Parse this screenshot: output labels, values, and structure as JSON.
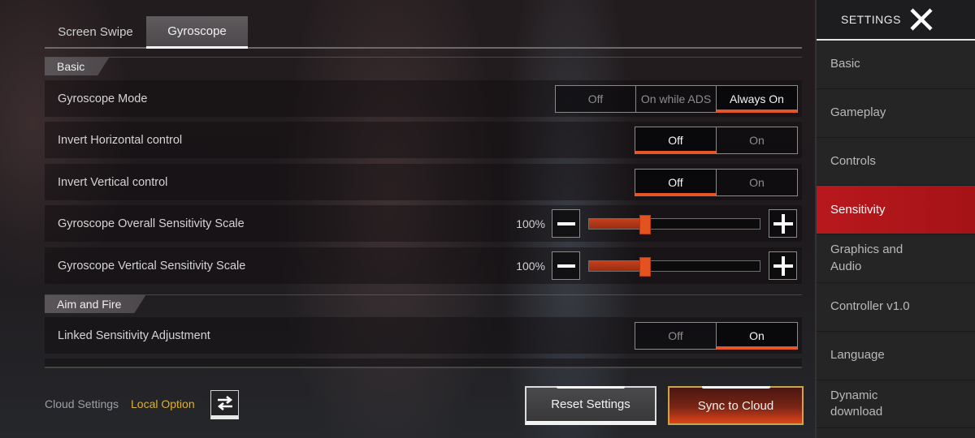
{
  "tabs": [
    {
      "label": "Screen Swipe",
      "active": false
    },
    {
      "label": "Gyroscope",
      "active": true
    }
  ],
  "sections": {
    "basic": "Basic",
    "aim_and_fire": "Aim and Fire"
  },
  "settings": {
    "gyroscope_mode": {
      "label": "Gyroscope Mode",
      "options": [
        "Off",
        "On while ADS",
        "Always On"
      ],
      "selected": "Always On"
    },
    "invert_horizontal": {
      "label": "Invert Horizontal control",
      "options": [
        "Off",
        "On"
      ],
      "selected": "Off"
    },
    "invert_vertical": {
      "label": "Invert Vertical control",
      "options": [
        "Off",
        "On"
      ],
      "selected": "Off"
    },
    "overall_sensitivity": {
      "label": "Gyroscope Overall Sensitivity Scale",
      "value_text": "100%",
      "slider_fraction": 0.33
    },
    "vertical_sensitivity": {
      "label": "Gyroscope Vertical Sensitivity Scale",
      "value_text": "100%",
      "slider_fraction": 0.33
    },
    "linked_sensitivity": {
      "label": "Linked Sensitivity Adjustment",
      "options": [
        "Off",
        "On"
      ],
      "selected": "On"
    }
  },
  "footer": {
    "cloud_label": "Cloud Settings",
    "cloud_value": "Local Option",
    "swap_icon": "swap-arrows-icon",
    "reset_label": "Reset Settings",
    "sync_label": "Sync to Cloud"
  },
  "sidebar": {
    "title": "SETTINGS",
    "close_icon": "close-x-icon",
    "items": [
      {
        "label": "Basic",
        "active": false
      },
      {
        "label": "Gameplay",
        "active": false
      },
      {
        "label": "Controls",
        "active": false
      },
      {
        "label": "Sensitivity",
        "active": true
      },
      {
        "label": "Graphics and Audio",
        "active": false
      },
      {
        "label": "Controller v1.0",
        "active": false
      },
      {
        "label": "Language",
        "active": false
      },
      {
        "label": "Dynamic download",
        "active": false
      }
    ]
  },
  "colors": {
    "accent_orange": "#e6542a",
    "active_nav_red": "#b8181d",
    "local_option_yellow": "#e0b02e"
  }
}
